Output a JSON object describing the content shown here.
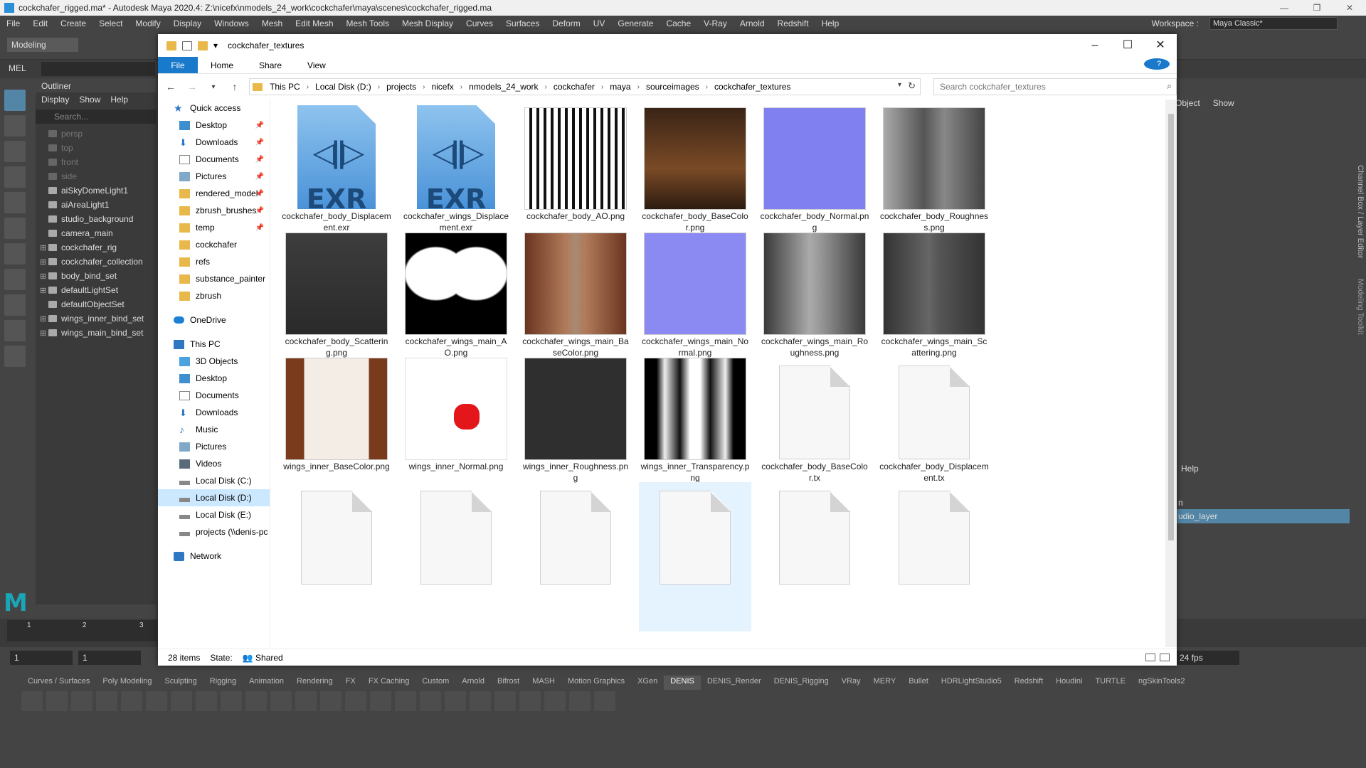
{
  "maya": {
    "title": "cockchafer_rigged.ma* - Autodesk Maya 2020.4: Z:\\nicefx\\nmodels_24_work\\cockchafer\\maya\\scenes\\cockchafer_rigged.ma",
    "menus": [
      "File",
      "Edit",
      "Create",
      "Select",
      "Modify",
      "Display",
      "Windows",
      "Mesh",
      "Edit Mesh",
      "Mesh Tools",
      "Mesh Display",
      "Curves",
      "Surfaces",
      "Deform",
      "UV",
      "Generate",
      "Cache",
      "V-Ray",
      "Arnold",
      "Redshift",
      "Help"
    ],
    "workspace_label": "Workspace :",
    "workspace_value": "Maya Classic*",
    "mode": "Modeling",
    "mel": "MEL",
    "outliner": {
      "title": "Outliner",
      "menus": [
        "Display",
        "Show",
        "Help"
      ],
      "search_placeholder": "Search...",
      "items": [
        {
          "label": "persp",
          "dim": true,
          "exp": false
        },
        {
          "label": "top",
          "dim": true,
          "exp": false
        },
        {
          "label": "front",
          "dim": true,
          "exp": false
        },
        {
          "label": "side",
          "dim": true,
          "exp": false
        },
        {
          "label": "aiSkyDomeLight1",
          "dim": false,
          "exp": false
        },
        {
          "label": "aiAreaLight1",
          "dim": false,
          "exp": false
        },
        {
          "label": "studio_background",
          "dim": false,
          "exp": false
        },
        {
          "label": "camera_main",
          "dim": false,
          "exp": false
        },
        {
          "label": "cockchafer_rig",
          "dim": false,
          "exp": true
        },
        {
          "label": "cockchafer_collection",
          "dim": false,
          "exp": true
        },
        {
          "label": "body_bind_set",
          "dim": false,
          "exp": true
        },
        {
          "label": "defaultLightSet",
          "dim": false,
          "exp": true
        },
        {
          "label": "defaultObjectSet",
          "dim": false,
          "exp": false
        },
        {
          "label": "wings_inner_bind_set",
          "dim": false,
          "exp": true
        },
        {
          "label": "wings_main_bind_set",
          "dim": false,
          "exp": true
        }
      ]
    },
    "right": {
      "menu": [
        "Object",
        "Show"
      ],
      "help": "Help",
      "layer0": "n",
      "layer": "udio_layer",
      "channel_box_tab": "Channel Box / Layer Editor",
      "modeling_toolkit_tab": "Modeling Toolkit"
    },
    "range": {
      "start": "1",
      "end": "1",
      "fps": "24 fps"
    },
    "timeline_ticks": [
      "1",
      "2",
      "3"
    ],
    "shelf_tabs": [
      "Curves / Surfaces",
      "Poly Modeling",
      "Sculpting",
      "Rigging",
      "Animation",
      "Rendering",
      "FX",
      "FX Caching",
      "Custom",
      "Arnold",
      "Bifrost",
      "MASH",
      "Motion Graphics",
      "XGen",
      "DENIS",
      "DENIS_Render",
      "DENIS_Rigging",
      "VRay",
      "MERY",
      "Bullet",
      "HDRLightStudio5",
      "Redshift",
      "Houdini",
      "TURTLE",
      "ngSkinTools2"
    ],
    "active_shelf": "DENIS"
  },
  "explorer": {
    "title": "cockchafer_textures",
    "ribbon": [
      "File",
      "Home",
      "Share",
      "View"
    ],
    "path": [
      "This PC",
      "Local Disk (D:)",
      "projects",
      "nicefx",
      "nmodels_24_work",
      "cockchafer",
      "maya",
      "sourceimages",
      "cockchafer_textures"
    ],
    "search_placeholder": "Search cockchafer_textures",
    "nav": [
      {
        "label": "Quick access",
        "icon": "star",
        "top": true,
        "pin": false
      },
      {
        "label": "Desktop",
        "icon": "",
        "top": false,
        "pin": true
      },
      {
        "label": "Downloads",
        "icon": "dl",
        "top": false,
        "pin": true
      },
      {
        "label": "Documents",
        "icon": "doc",
        "top": false,
        "pin": true
      },
      {
        "label": "Pictures",
        "icon": "pic",
        "top": false,
        "pin": true
      },
      {
        "label": "rendered_model",
        "icon": "y",
        "top": false,
        "pin": true
      },
      {
        "label": "zbrush_brushes",
        "icon": "y",
        "top": false,
        "pin": true
      },
      {
        "label": "temp",
        "icon": "y",
        "top": false,
        "pin": true
      },
      {
        "label": "cockchafer",
        "icon": "y",
        "top": false,
        "pin": false
      },
      {
        "label": "refs",
        "icon": "y",
        "top": false,
        "pin": false
      },
      {
        "label": "substance_painter",
        "icon": "y",
        "top": false,
        "pin": false
      },
      {
        "label": "zbrush",
        "icon": "y",
        "top": false,
        "pin": false
      },
      {
        "label": "",
        "icon": "gap",
        "top": false,
        "pin": false
      },
      {
        "label": "OneDrive",
        "icon": "cloud",
        "top": true,
        "pin": false
      },
      {
        "label": "",
        "icon": "gap",
        "top": false,
        "pin": false
      },
      {
        "label": "This PC",
        "icon": "pc",
        "top": true,
        "pin": false
      },
      {
        "label": "3D Objects",
        "icon": "obj",
        "top": false,
        "pin": false
      },
      {
        "label": "Desktop",
        "icon": "",
        "top": false,
        "pin": false
      },
      {
        "label": "Documents",
        "icon": "doc",
        "top": false,
        "pin": false
      },
      {
        "label": "Downloads",
        "icon": "dl",
        "top": false,
        "pin": false
      },
      {
        "label": "Music",
        "icon": "mus",
        "top": false,
        "pin": false
      },
      {
        "label": "Pictures",
        "icon": "pic",
        "top": false,
        "pin": false
      },
      {
        "label": "Videos",
        "icon": "vid",
        "top": false,
        "pin": false
      },
      {
        "label": "Local Disk (C:)",
        "icon": "drv",
        "top": false,
        "pin": false
      },
      {
        "label": "Local Disk (D:)",
        "icon": "drv",
        "top": false,
        "pin": false,
        "selected": true
      },
      {
        "label": "Local Disk (E:)",
        "icon": "drv",
        "top": false,
        "pin": false
      },
      {
        "label": "projects (\\\\denis-pc",
        "icon": "drv",
        "top": false,
        "pin": false
      },
      {
        "label": "",
        "icon": "gap",
        "top": false,
        "pin": false
      },
      {
        "label": "Network",
        "icon": "net",
        "top": true,
        "pin": false
      }
    ],
    "files": [
      {
        "name": "cockchafer_body_Displacement.exr",
        "thumb": "exr"
      },
      {
        "name": "cockchafer_wings_Displacement.exr",
        "thumb": "exr"
      },
      {
        "name": "cockchafer_body_AO.png",
        "thumb": "uvbw"
      },
      {
        "name": "cockchafer_body_BaseColor.png",
        "thumb": "uvbase"
      },
      {
        "name": "cockchafer_body_Normal.png",
        "thumb": "uvnorm"
      },
      {
        "name": "cockchafer_body_Roughness.png",
        "thumb": "uvrough"
      },
      {
        "name": "cockchafer_body_Scattering.png",
        "thumb": "uvscat"
      },
      {
        "name": "cockchafer_wings_main_AO.png",
        "thumb": "wao"
      },
      {
        "name": "cockchafer_wings_main_BaseColor.png",
        "thumb": "wbase"
      },
      {
        "name": "cockchafer_wings_main_Normal.png",
        "thumb": "wnorm"
      },
      {
        "name": "cockchafer_wings_main_Roughness.png",
        "thumb": "wrough"
      },
      {
        "name": "cockchafer_wings_main_Scattering.png",
        "thumb": "wscat"
      },
      {
        "name": "wings_inner_BaseColor.png",
        "thumb": "ibase"
      },
      {
        "name": "wings_inner_Normal.png",
        "thumb": "inorm"
      },
      {
        "name": "wings_inner_Roughness.png",
        "thumb": "irough"
      },
      {
        "name": "wings_inner_Transparency.png",
        "thumb": "itrans"
      },
      {
        "name": "cockchafer_body_BaseColor.tx",
        "thumb": "doc"
      },
      {
        "name": "cockchafer_body_Displacement.tx",
        "thumb": "doc"
      },
      {
        "name": "",
        "thumb": "doc"
      },
      {
        "name": "",
        "thumb": "doc"
      },
      {
        "name": "",
        "thumb": "doc"
      },
      {
        "name": "",
        "thumb": "doc",
        "highlight": true
      },
      {
        "name": "",
        "thumb": "doc"
      },
      {
        "name": "",
        "thumb": "doc"
      }
    ],
    "status": {
      "count": "28 items",
      "state": "State:",
      "shared": "Shared"
    }
  }
}
